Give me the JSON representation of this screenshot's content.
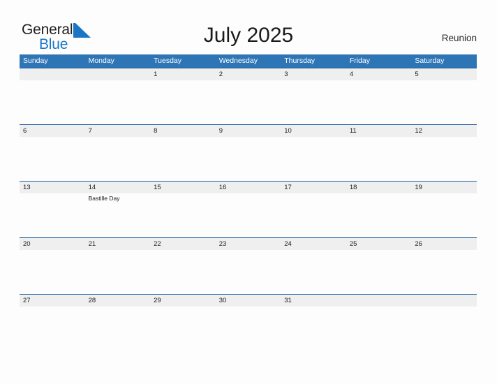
{
  "brand": {
    "name_part1": "General",
    "name_part2": "Blue",
    "mark_icon": "triangle-flag-icon",
    "color_primary": "#1a76c4",
    "color_text": "#231f20"
  },
  "header": {
    "title": "July 2025",
    "location": "Reunion"
  },
  "calendar": {
    "header_color": "#2e75b6",
    "band_color": "#efefef",
    "border_color": "#1f5fa0",
    "weekdays": [
      "Sunday",
      "Monday",
      "Tuesday",
      "Wednesday",
      "Thursday",
      "Friday",
      "Saturday"
    ],
    "weeks": [
      [
        {
          "date": "",
          "events": []
        },
        {
          "date": "",
          "events": []
        },
        {
          "date": "1",
          "events": []
        },
        {
          "date": "2",
          "events": []
        },
        {
          "date": "3",
          "events": []
        },
        {
          "date": "4",
          "events": []
        },
        {
          "date": "5",
          "events": []
        }
      ],
      [
        {
          "date": "6",
          "events": []
        },
        {
          "date": "7",
          "events": []
        },
        {
          "date": "8",
          "events": []
        },
        {
          "date": "9",
          "events": []
        },
        {
          "date": "10",
          "events": []
        },
        {
          "date": "11",
          "events": []
        },
        {
          "date": "12",
          "events": []
        }
      ],
      [
        {
          "date": "13",
          "events": []
        },
        {
          "date": "14",
          "events": [
            "Bastille Day"
          ]
        },
        {
          "date": "15",
          "events": []
        },
        {
          "date": "16",
          "events": []
        },
        {
          "date": "17",
          "events": []
        },
        {
          "date": "18",
          "events": []
        },
        {
          "date": "19",
          "events": []
        }
      ],
      [
        {
          "date": "20",
          "events": []
        },
        {
          "date": "21",
          "events": []
        },
        {
          "date": "22",
          "events": []
        },
        {
          "date": "23",
          "events": []
        },
        {
          "date": "24",
          "events": []
        },
        {
          "date": "25",
          "events": []
        },
        {
          "date": "26",
          "events": []
        }
      ],
      [
        {
          "date": "27",
          "events": []
        },
        {
          "date": "28",
          "events": []
        },
        {
          "date": "29",
          "events": []
        },
        {
          "date": "30",
          "events": []
        },
        {
          "date": "31",
          "events": []
        },
        {
          "date": "",
          "events": []
        },
        {
          "date": "",
          "events": []
        }
      ]
    ]
  }
}
